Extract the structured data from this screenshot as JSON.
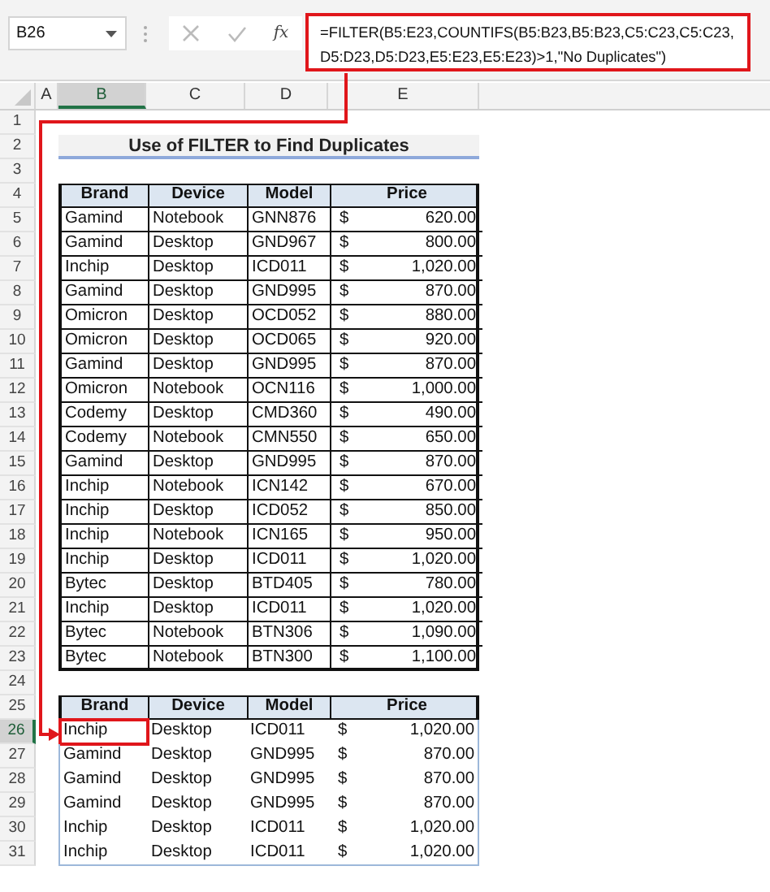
{
  "name_box": "B26",
  "function_label": "fx",
  "formula": [
    "=FILTER(B5:E23,COUNTIFS(B5:B23,B5:B23,C5:C23,C5:C23,",
    "D5:D23,D5:D23,E5:E23,E5:E23)>1,\"No Duplicates\")"
  ],
  "columns": [
    {
      "label": "A",
      "selected": false
    },
    {
      "label": "B",
      "selected": true
    },
    {
      "label": "C",
      "selected": false
    },
    {
      "label": "D",
      "selected": false
    },
    {
      "label": "E",
      "selected": false
    }
  ],
  "row_numbers": [
    {
      "label": "1",
      "selected": false
    },
    {
      "label": "2",
      "selected": false
    },
    {
      "label": "3",
      "selected": false
    },
    {
      "label": "4",
      "selected": false
    },
    {
      "label": "5",
      "selected": false
    },
    {
      "label": "6",
      "selected": false
    },
    {
      "label": "7",
      "selected": false
    },
    {
      "label": "8",
      "selected": false
    },
    {
      "label": "9",
      "selected": false
    },
    {
      "label": "10",
      "selected": false
    },
    {
      "label": "11",
      "selected": false
    },
    {
      "label": "12",
      "selected": false
    },
    {
      "label": "13",
      "selected": false
    },
    {
      "label": "14",
      "selected": false
    },
    {
      "label": "15",
      "selected": false
    },
    {
      "label": "16",
      "selected": false
    },
    {
      "label": "17",
      "selected": false
    },
    {
      "label": "18",
      "selected": false
    },
    {
      "label": "19",
      "selected": false
    },
    {
      "label": "20",
      "selected": false
    },
    {
      "label": "21",
      "selected": false
    },
    {
      "label": "22",
      "selected": false
    },
    {
      "label": "23",
      "selected": false
    },
    {
      "label": "24",
      "selected": false
    },
    {
      "label": "25",
      "selected": false
    },
    {
      "label": "26",
      "selected": true
    },
    {
      "label": "27",
      "selected": false
    },
    {
      "label": "28",
      "selected": false
    },
    {
      "label": "29",
      "selected": false
    },
    {
      "label": "30",
      "selected": false
    },
    {
      "label": "31",
      "selected": false
    }
  ],
  "title": "Use of FILTER to Find Duplicates",
  "source_table": {
    "columns": [
      "Brand",
      "Device",
      "Model",
      "Price"
    ],
    "rows": [
      [
        "Gamind",
        "Notebook",
        "GNN876",
        {
          "currency": "$",
          "amount": "620.00"
        }
      ],
      [
        "Gamind",
        "Desktop",
        "GND967",
        {
          "currency": "$",
          "amount": "800.00"
        }
      ],
      [
        "Inchip",
        "Desktop",
        "ICD011",
        {
          "currency": "$",
          "amount": "1,020.00"
        }
      ],
      [
        "Gamind",
        "Desktop",
        "GND995",
        {
          "currency": "$",
          "amount": "870.00"
        }
      ],
      [
        "Omicron",
        "Desktop",
        "OCD052",
        {
          "currency": "$",
          "amount": "880.00"
        }
      ],
      [
        "Omicron",
        "Desktop",
        "OCD065",
        {
          "currency": "$",
          "amount": "920.00"
        }
      ],
      [
        "Gamind",
        "Desktop",
        "GND995",
        {
          "currency": "$",
          "amount": "870.00"
        }
      ],
      [
        "Omicron",
        "Notebook",
        "OCN116",
        {
          "currency": "$",
          "amount": "1,000.00"
        }
      ],
      [
        "Codemy",
        "Desktop",
        "CMD360",
        {
          "currency": "$",
          "amount": "490.00"
        }
      ],
      [
        "Codemy",
        "Notebook",
        "CMN550",
        {
          "currency": "$",
          "amount": "650.00"
        }
      ],
      [
        "Gamind",
        "Desktop",
        "GND995",
        {
          "currency": "$",
          "amount": "870.00"
        }
      ],
      [
        "Inchip",
        "Notebook",
        "ICN142",
        {
          "currency": "$",
          "amount": "670.00"
        }
      ],
      [
        "Inchip",
        "Desktop",
        "ICD052",
        {
          "currency": "$",
          "amount": "850.00"
        }
      ],
      [
        "Inchip",
        "Notebook",
        "ICN165",
        {
          "currency": "$",
          "amount": "950.00"
        }
      ],
      [
        "Inchip",
        "Desktop",
        "ICD011",
        {
          "currency": "$",
          "amount": "1,020.00"
        }
      ],
      [
        "Bytec",
        "Desktop",
        "BTD405",
        {
          "currency": "$",
          "amount": "780.00"
        }
      ],
      [
        "Inchip",
        "Desktop",
        "ICD011",
        {
          "currency": "$",
          "amount": "1,020.00"
        }
      ],
      [
        "Bytec",
        "Notebook",
        "BTN306",
        {
          "currency": "$",
          "amount": "1,090.00"
        }
      ],
      [
        "Bytec",
        "Notebook",
        "BTN300",
        {
          "currency": "$",
          "amount": "1,100.00"
        }
      ]
    ]
  },
  "result_table": {
    "columns": [
      "Brand",
      "Device",
      "Model",
      "Price"
    ],
    "rows": [
      {
        "cells": [
          "Inchip",
          "Desktop",
          "ICD011",
          {
            "currency": "$",
            "amount": "1,020.00"
          }
        ],
        "highlighted": true
      },
      {
        "cells": [
          "Gamind",
          "Desktop",
          "GND995",
          {
            "currency": "$",
            "amount": "870.00"
          }
        ],
        "highlighted": false
      },
      {
        "cells": [
          "Gamind",
          "Desktop",
          "GND995",
          {
            "currency": "$",
            "amount": "870.00"
          }
        ],
        "highlighted": false
      },
      {
        "cells": [
          "Gamind",
          "Desktop",
          "GND995",
          {
            "currency": "$",
            "amount": "870.00"
          }
        ],
        "highlighted": false
      },
      {
        "cells": [
          "Inchip",
          "Desktop",
          "ICD011",
          {
            "currency": "$",
            "amount": "1,020.00"
          }
        ],
        "highlighted": false
      },
      {
        "cells": [
          "Inchip",
          "Desktop",
          "ICD011",
          {
            "currency": "$",
            "amount": "1,020.00"
          }
        ],
        "highlighted": false
      }
    ]
  }
}
